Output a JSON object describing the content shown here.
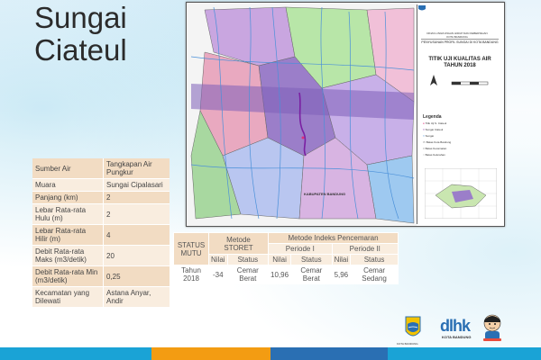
{
  "slide": {
    "title_line1": "Sungai",
    "title_line2": "Ciateul"
  },
  "info_table": [
    {
      "label": "Sumber Air",
      "value": "Tangkapan Air Pungkur"
    },
    {
      "label": "Muara",
      "value": "Sungai Cipalasari"
    },
    {
      "label": "Panjang (km)",
      "value": "2"
    },
    {
      "label": "Lebar Rata-rata Hulu (m)",
      "value": "2"
    },
    {
      "label": "Lebar Rata-rata Hilir (m)",
      "value": "4"
    },
    {
      "label": "Debit Rata-rata Maks (m3/detik)",
      "value": "20"
    },
    {
      "label": "Debit Rata-rata Min (m3/detik)",
      "value": "0,25"
    },
    {
      "label": "Kecamatan yang Dilewati",
      "value": "Astana Anyar, Andir"
    }
  ],
  "map": {
    "header_text": "DINAS LINGKUNGAN HIDUP DAN KEBERSIHAN KOTA BANDUNG",
    "subtitle": "PENYUSUNAN PROFIL SUNGAI DI KOTA BANDUNG",
    "title": "TITIK UJI KUALITAS AIR TAHUN 2018",
    "legend_title": "Legenda",
    "legend_items": [
      "Titik Uji S. Ciateul",
      "Sungai Ciateul",
      "Sungai",
      "Batas Kota Bandung",
      "Batas Kecamatan",
      "Batas Kelurahan"
    ],
    "region_label": "KABUPATEN BANDUNG",
    "colors": {
      "river_highlight": "#7a1fa2",
      "rivers": "#4a90d9",
      "zones": [
        "#c9a6e0",
        "#b9c6f0",
        "#d8b4e2",
        "#a8d8a0",
        "#e9a9c0",
        "#b8e6a8",
        "#f1c0d8",
        "#9ec9f0"
      ]
    }
  },
  "pollution_table": {
    "header_status": "STATUS MUTU",
    "header_storet": "Metode STORET",
    "header_ip": "Metode Indeks Pencemaran",
    "period1": "Periode I",
    "period2": "Periode II",
    "col_nilai": "Nilai",
    "col_status": "Status",
    "row_label": "Tahun 2018",
    "storet_nilai": "-34",
    "storet_status": "Cemar Berat",
    "p1_nilai": "10,96",
    "p1_status": "Cemar Berat",
    "p2_nilai": "5,96",
    "p2_status": "Cemar Sedang"
  },
  "footer": {
    "logo_caption": "KOTA BANDUNG",
    "dlhk_text": "dlhk",
    "dlhk_caption": "KOTA BANDUNG",
    "bar_colors": [
      "#1aa3d6",
      "#f39c12",
      "#2a6fb3",
      "#1aa3d6"
    ]
  }
}
